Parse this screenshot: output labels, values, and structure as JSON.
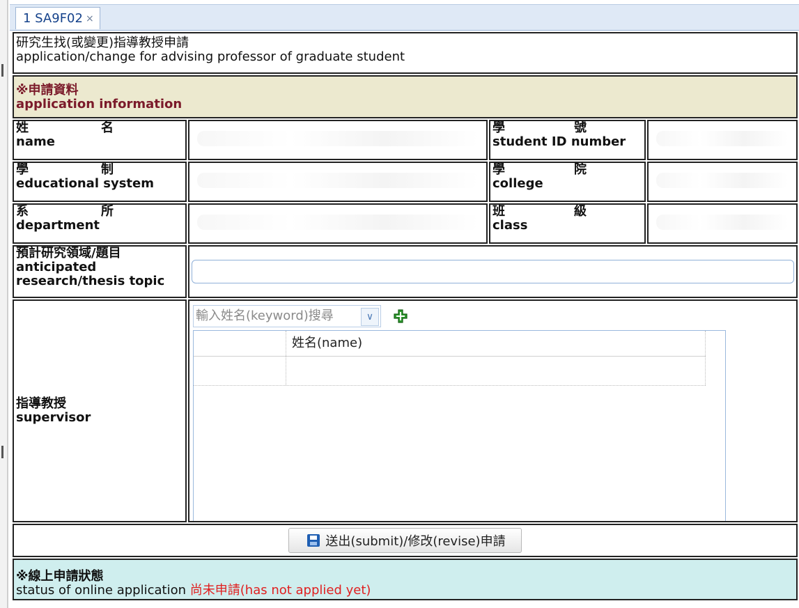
{
  "tab": {
    "label": "1 SA9F02",
    "close": "×"
  },
  "form": {
    "title_zh": "研究生找(或變更)指導教授申請",
    "title_en": "application/change for advising professor of graduate student",
    "section_zh": "※申請資料",
    "section_en": "application information",
    "fields": {
      "name": {
        "zh1": "姓",
        "zh2": "名",
        "en": "name"
      },
      "student_id": {
        "zh1": "學",
        "zh2": "號",
        "en": "student ID number"
      },
      "edu_system": {
        "zh1": "學",
        "zh2": "制",
        "en": "educational system"
      },
      "college": {
        "zh1": "學",
        "zh2": "院",
        "en": "college"
      },
      "department": {
        "zh1": "系",
        "zh2": "所",
        "en": "department"
      },
      "class": {
        "zh1": "班",
        "zh2": "級",
        "en": "class"
      },
      "topic": {
        "zh": "預計研究領域/題目",
        "en1": "anticipated",
        "en2": "research/thesis topic"
      },
      "supervisor": {
        "zh": "指導教授",
        "en": "supervisor"
      }
    },
    "supervisor_search": {
      "placeholder": "輸入姓名(keyword)搜尋"
    },
    "grid": {
      "column_name": "姓名(name)"
    },
    "submit_label": "送出(submit)/修改(revise)申請",
    "status": {
      "zh": "※線上申請狀態",
      "en": "status of online application",
      "value": "尚未申請(has not applied yet)"
    }
  },
  "colors": {
    "beige": "#ece9cf",
    "cyan": "#cfeeee",
    "status_red": "#e02020",
    "tab_blue": "#15428b"
  }
}
